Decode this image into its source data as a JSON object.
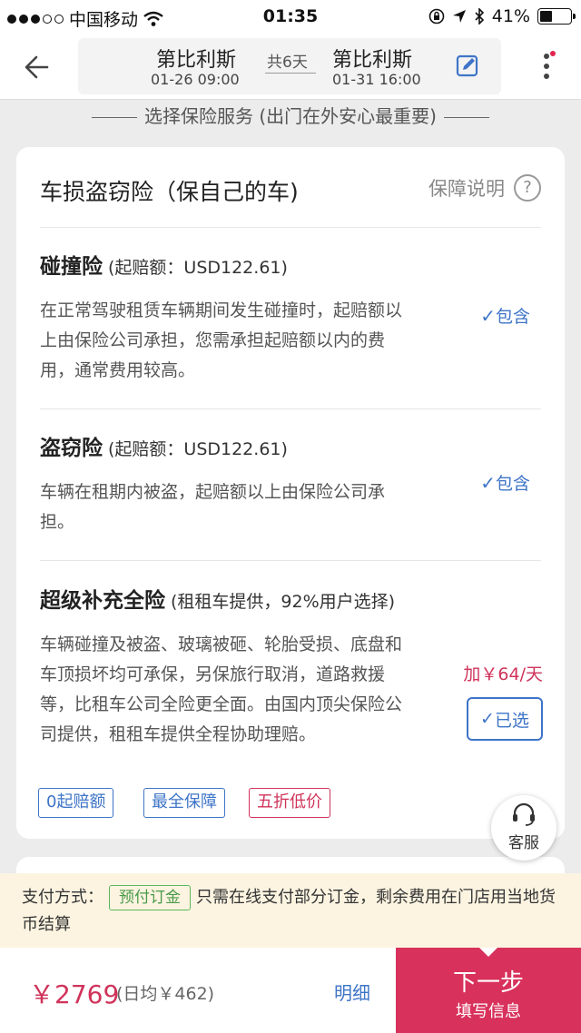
{
  "statusbar": {
    "carrier": "中国移动",
    "time": "01:35",
    "battery": "41%"
  },
  "header": {
    "from_city": "第比利斯",
    "from_datetime": "01-26 09:00",
    "to_city": "第比利斯",
    "to_datetime": "01-31 16:00",
    "duration": "共6天"
  },
  "section_title": "选择保险服务 (出门在外安心最重要)",
  "card": {
    "title": "车损盗窃险（保自己的车)",
    "help_label": "保障说明",
    "items": [
      {
        "name": "碰撞险",
        "sub": "(起赔额：USD122.61)",
        "desc": "在正常驾驶租赁车辆期间发生碰撞时，起赔额以上由保险公司承担，您需承担起赔额以内的费用，通常费用较高。",
        "status": "包含"
      },
      {
        "name": "盗窃险",
        "sub": "(起赔额：USD122.61)",
        "desc": "车辆在租期内被盗，起赔额以上由保险公司承担。",
        "status": "包含"
      },
      {
        "name": "超级补充全险",
        "sub": "(租租车提供，92%用户选择)",
        "desc": "车辆碰撞及被盗、玻璃被砸、轮胎受损、底盘和车顶损坏均可承保，另保旅行取消，道路救援等，比租车公司全险更全面。由国内顶尖保险公司提供，租租车提供全程协助理赔。",
        "price": "加￥64/天",
        "button": "已选"
      }
    ],
    "tags": [
      "0起赔额",
      "最全保障",
      "五折低价"
    ]
  },
  "customer_service": "客服",
  "notice": {
    "label": "支付方式：",
    "badge": "预付订金",
    "text": "只需在线支付部分订金，剩余费用在门店用当地货币结算"
  },
  "footer": {
    "total": "￥2769",
    "daily": "(日均￥462)",
    "detail": "明细",
    "next_main": "下一步",
    "next_sub": "填写信息"
  },
  "colors": {
    "accent": "#d8315c",
    "link": "#3e74c7",
    "notice_bg": "#fcf4e1"
  }
}
